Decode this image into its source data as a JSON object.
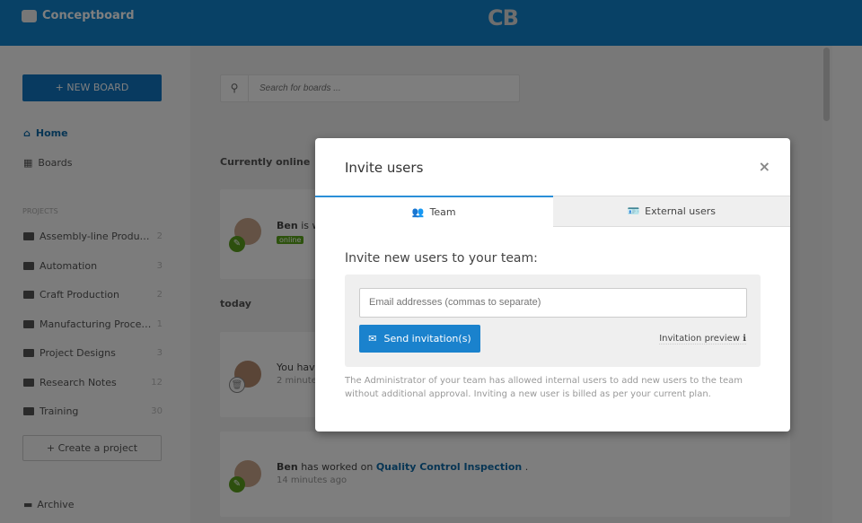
{
  "header": {
    "brand": "Conceptboard",
    "logo": "CB"
  },
  "sidebar": {
    "new_board": "+ NEW BOARD",
    "nav": [
      {
        "label": "Home",
        "icon": "home-icon"
      },
      {
        "label": "Boards",
        "icon": "grid-icon"
      }
    ],
    "projects_label": "PROJECTS",
    "projects": [
      {
        "name": "Assembly-line Producti...",
        "count": "2"
      },
      {
        "name": "Automation",
        "count": "3"
      },
      {
        "name": "Craft Production",
        "count": "2"
      },
      {
        "name": "Manufacturing Process",
        "count": "1"
      },
      {
        "name": "Project Designs",
        "count": "3"
      },
      {
        "name": "Research Notes",
        "count": "12"
      },
      {
        "name": "Training",
        "count": "30"
      }
    ],
    "create_project": "+ Create a project",
    "archive": "Archive"
  },
  "main": {
    "search_placeholder": "Search for boards ...",
    "currently_online": "Currently online",
    "today": "today",
    "online_card": {
      "name": "Ben",
      "text": "is w",
      "badge": "online"
    },
    "card2": {
      "text": "You have",
      "time": "2 minute"
    },
    "card3": {
      "name": "Ben",
      "text": "has worked on",
      "link": "Quality Control Inspection",
      "suffix": " .",
      "time": "14 minutes ago"
    }
  },
  "modal": {
    "title": "Invite users",
    "close": "×",
    "tabs": [
      {
        "label": "Team",
        "icon": "team-icon",
        "active": true
      },
      {
        "label": "External users",
        "icon": "id-card-icon",
        "active": false
      }
    ],
    "heading": "Invite new users to your team:",
    "email_placeholder": "Email addresses (commas to separate)",
    "send": "Send invitation(s)",
    "preview": "Invitation preview",
    "note": "The Administrator of your team has allowed internal users to add new users to the team without additional approval. Inviting a new user is billed as per your current plan."
  },
  "colors": {
    "brand": "#1083cd",
    "accent": "#1a82cd",
    "online": "#5aa51b"
  }
}
